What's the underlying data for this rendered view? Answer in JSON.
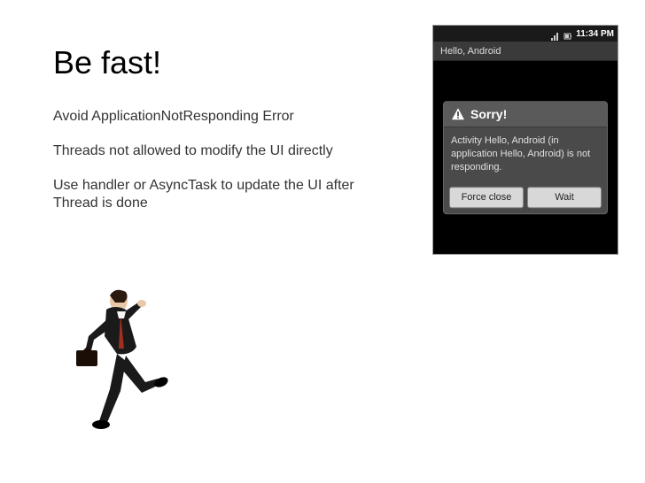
{
  "slide": {
    "title": "Be fast!",
    "paragraphs": [
      "Avoid ApplicationNotResponding Error",
      "Threads not allowed to modify the UI directly",
      "Use handler or AsyncTask to update the UI after Thread is done"
    ]
  },
  "phone": {
    "status_time": "11:34 PM",
    "app_title": "Hello, Android",
    "dialog": {
      "title": "Sorry!",
      "message": "Activity Hello, Android (in application Hello, Android) is not responding.",
      "force_close_label": "Force close",
      "wait_label": "Wait"
    }
  },
  "images": {
    "running_man_alt": "running businessman with briefcase",
    "warning_icon": "warning-icon"
  }
}
